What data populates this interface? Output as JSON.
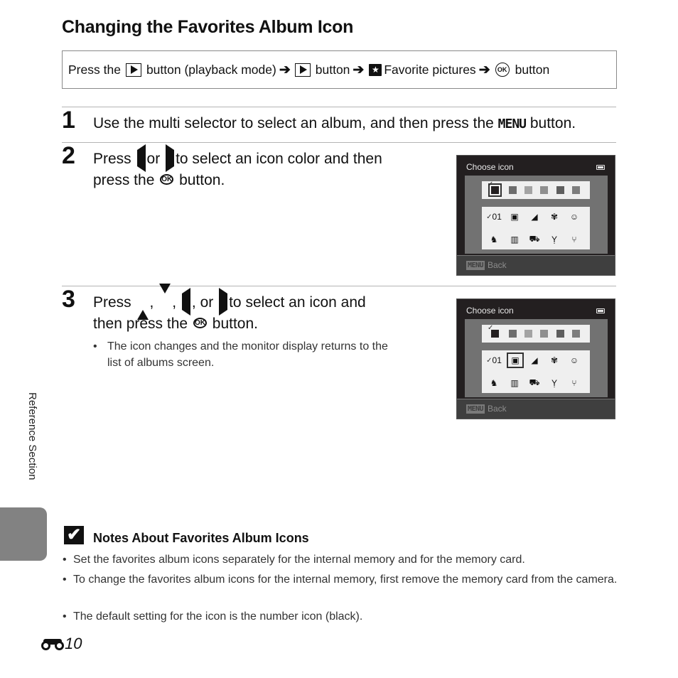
{
  "title": "Changing the Favorites Album Icon",
  "path": {
    "parts": [
      "Press the",
      "button (playback mode)",
      "button",
      "Favorite pictures",
      "button"
    ],
    "icons": [
      "playback-button-icon",
      "arrow-right-icon",
      "playback-button-icon",
      "arrow-right-icon",
      "favorite-pictures-icon",
      "arrow-right-icon",
      "ok-button-icon"
    ],
    "ok_label": "OK",
    "fav_glyph": "★",
    "arrow_glyph": "➔"
  },
  "steps": [
    {
      "number": "1",
      "text_a": "Use the multi selector to select an album, and then press the",
      "menu": "MENU",
      "text_b": "button."
    },
    {
      "number": "2",
      "text_a": "Press",
      "or": "or",
      "text_b": "to select an icon color and then",
      "text_c": "press the",
      "text_d": "button."
    },
    {
      "number": "3",
      "text_a": "Press",
      "comma": ",",
      "or": ", or",
      "text_b": "to select an icon and",
      "text_c": "then press the",
      "text_d": "button.",
      "bullet_line1": "The icon changes and the monitor display returns to the",
      "bullet_line2": "list of albums screen."
    }
  ],
  "ok_label": "OK",
  "bullet": "•",
  "camera_screens": [
    {
      "title": "Choose icon",
      "footer_menu": "MENU",
      "footer_label": "Back",
      "selected_row": "color",
      "selected_color_index": 0,
      "selected_icon_index": -1
    },
    {
      "title": "Choose icon",
      "footer_menu": "MENU",
      "footer_label": "Back",
      "selected_row": "icon",
      "selected_color_index": 0,
      "selected_icon_index": 1
    }
  ],
  "icon_colors": [
    "#231f20",
    "#6d6d6d",
    "#a3a3a3",
    "#8f8f8f",
    "#5e5e5e",
    "#7d7d7d"
  ],
  "album_icons": [
    {
      "name": "number-icon",
      "glyph": "01"
    },
    {
      "name": "suitcase-icon",
      "glyph": "▣"
    },
    {
      "name": "landscape-icon",
      "glyph": "◢"
    },
    {
      "name": "flower-icon",
      "glyph": "✾"
    },
    {
      "name": "face-icon",
      "glyph": "☺"
    },
    {
      "name": "pet-icon",
      "glyph": "♞"
    },
    {
      "name": "building-icon",
      "glyph": "▥"
    },
    {
      "name": "car-icon",
      "glyph": "⛟"
    },
    {
      "name": "cocktail-icon",
      "glyph": "Ỵ"
    },
    {
      "name": "cutlery-icon",
      "glyph": "⑂"
    }
  ],
  "check_glyph": "✓",
  "side_label": "Reference Section",
  "note": {
    "check_glyph": "✔",
    "title": "Notes About Favorites Album Icons",
    "items": [
      "Set the favorites album icons separately for the internal memory and for the memory card.",
      "To change the favorites album icons for the internal memory, first remove the memory card from the camera.",
      "The default setting for the icon is the number icon (black)."
    ]
  },
  "page_number": "10"
}
